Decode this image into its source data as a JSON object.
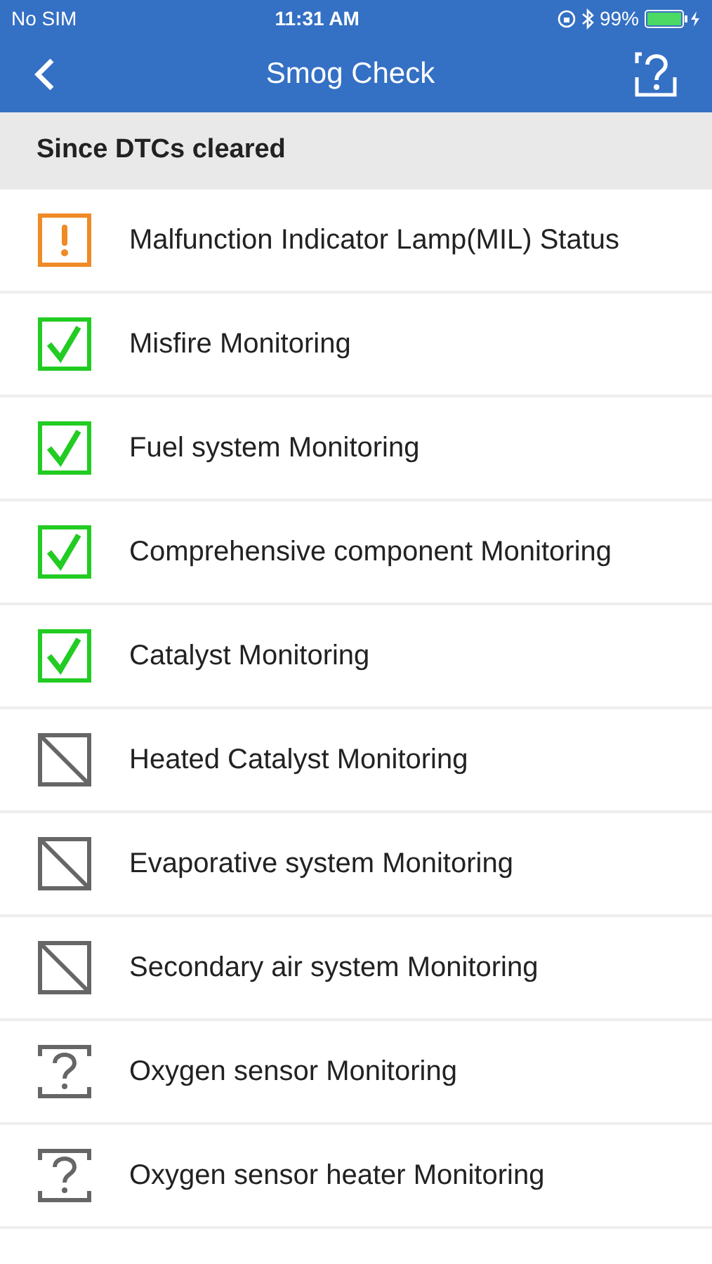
{
  "status_bar": {
    "carrier": "No SIM",
    "time": "11:31 AM",
    "battery": "99%"
  },
  "nav": {
    "title": "Smog Check"
  },
  "section": {
    "title": "Since DTCs cleared"
  },
  "monitors": [
    {
      "name": "Malfunction Indicator Lamp(MIL) Status",
      "kind": "warning"
    },
    {
      "name": "Misfire Monitoring",
      "kind": "complete"
    },
    {
      "name": "Fuel system Monitoring",
      "kind": "complete"
    },
    {
      "name": "Comprehensive component Monitoring",
      "kind": "complete"
    },
    {
      "name": "Catalyst Monitoring",
      "kind": "complete"
    },
    {
      "name": "Heated Catalyst Monitoring",
      "kind": "unsupported"
    },
    {
      "name": "Evaporative system Monitoring",
      "kind": "unsupported"
    },
    {
      "name": "Secondary air system Monitoring",
      "kind": "unsupported"
    },
    {
      "name": "Oxygen sensor Monitoring",
      "kind": "unknown"
    },
    {
      "name": "Oxygen sensor heater Monitoring",
      "kind": "unknown"
    }
  ]
}
